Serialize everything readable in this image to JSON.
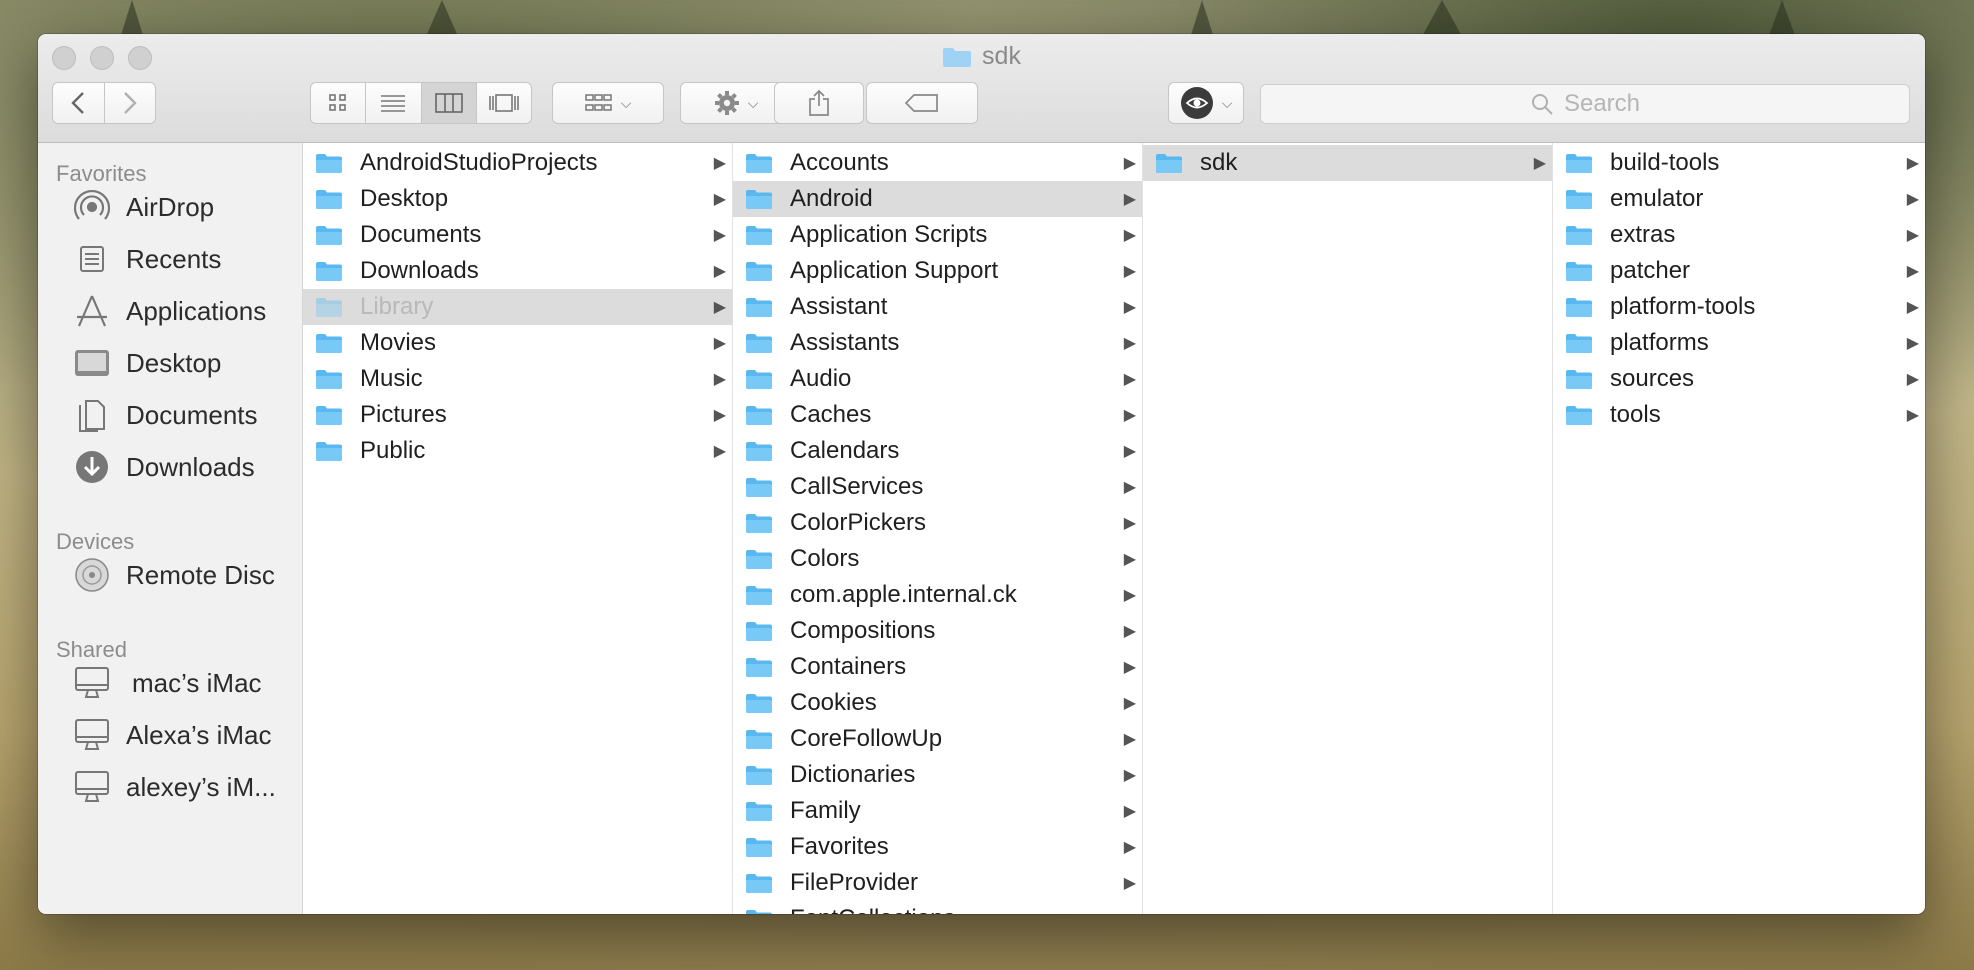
{
  "window": {
    "title": "sdk"
  },
  "toolbar": {
    "search_placeholder": "Search"
  },
  "sidebar": {
    "favorites_header": "Favorites",
    "devices_header": "Devices",
    "shared_header": "Shared",
    "favorites": [
      {
        "label": "AirDrop",
        "icon": "airdrop-icon"
      },
      {
        "label": "Recents",
        "icon": "recents-icon"
      },
      {
        "label": "Applications",
        "icon": "applications-icon"
      },
      {
        "label": "Desktop",
        "icon": "desktop-icon"
      },
      {
        "label": "Documents",
        "icon": "documents-icon"
      },
      {
        "label": "Downloads",
        "icon": "downloads-icon"
      }
    ],
    "devices": [
      {
        "label": "Remote Disc",
        "icon": "disc-icon"
      }
    ],
    "shared": [
      {
        "label": "mac’s iMac",
        "icon": "imac-icon"
      },
      {
        "label": "Alexa’s iMac",
        "icon": "imac-icon"
      },
      {
        "label": "alexey’s iM...",
        "icon": "imac-icon"
      }
    ]
  },
  "columns": [
    {
      "items": [
        {
          "name": "AndroidStudioProjects"
        },
        {
          "name": "Desktop"
        },
        {
          "name": "Documents"
        },
        {
          "name": "Downloads"
        },
        {
          "name": "Library",
          "selected": true,
          "dimmed": true
        },
        {
          "name": "Movies"
        },
        {
          "name": "Music"
        },
        {
          "name": "Pictures"
        },
        {
          "name": "Public"
        }
      ]
    },
    {
      "items": [
        {
          "name": "Accounts"
        },
        {
          "name": "Android",
          "selected": true
        },
        {
          "name": "Application Scripts"
        },
        {
          "name": "Application Support"
        },
        {
          "name": "Assistant"
        },
        {
          "name": "Assistants"
        },
        {
          "name": "Audio"
        },
        {
          "name": "Caches"
        },
        {
          "name": "Calendars"
        },
        {
          "name": "CallServices"
        },
        {
          "name": "ColorPickers"
        },
        {
          "name": "Colors"
        },
        {
          "name": "com.apple.internal.ck"
        },
        {
          "name": "Compositions"
        },
        {
          "name": "Containers"
        },
        {
          "name": "Cookies"
        },
        {
          "name": "CoreFollowUp"
        },
        {
          "name": "Dictionaries"
        },
        {
          "name": "Family"
        },
        {
          "name": "Favorites"
        },
        {
          "name": "FileProvider"
        },
        {
          "name": "FontCollections"
        }
      ]
    },
    {
      "items": [
        {
          "name": "sdk",
          "selected": true
        }
      ]
    },
    {
      "items": [
        {
          "name": "build-tools"
        },
        {
          "name": "emulator"
        },
        {
          "name": "extras"
        },
        {
          "name": "patcher"
        },
        {
          "name": "platform-tools"
        },
        {
          "name": "platforms"
        },
        {
          "name": "sources"
        },
        {
          "name": "tools"
        }
      ]
    }
  ],
  "colors": {
    "folder_blue": "#5ab8f0",
    "selection_gray": "#dcdcdc"
  }
}
